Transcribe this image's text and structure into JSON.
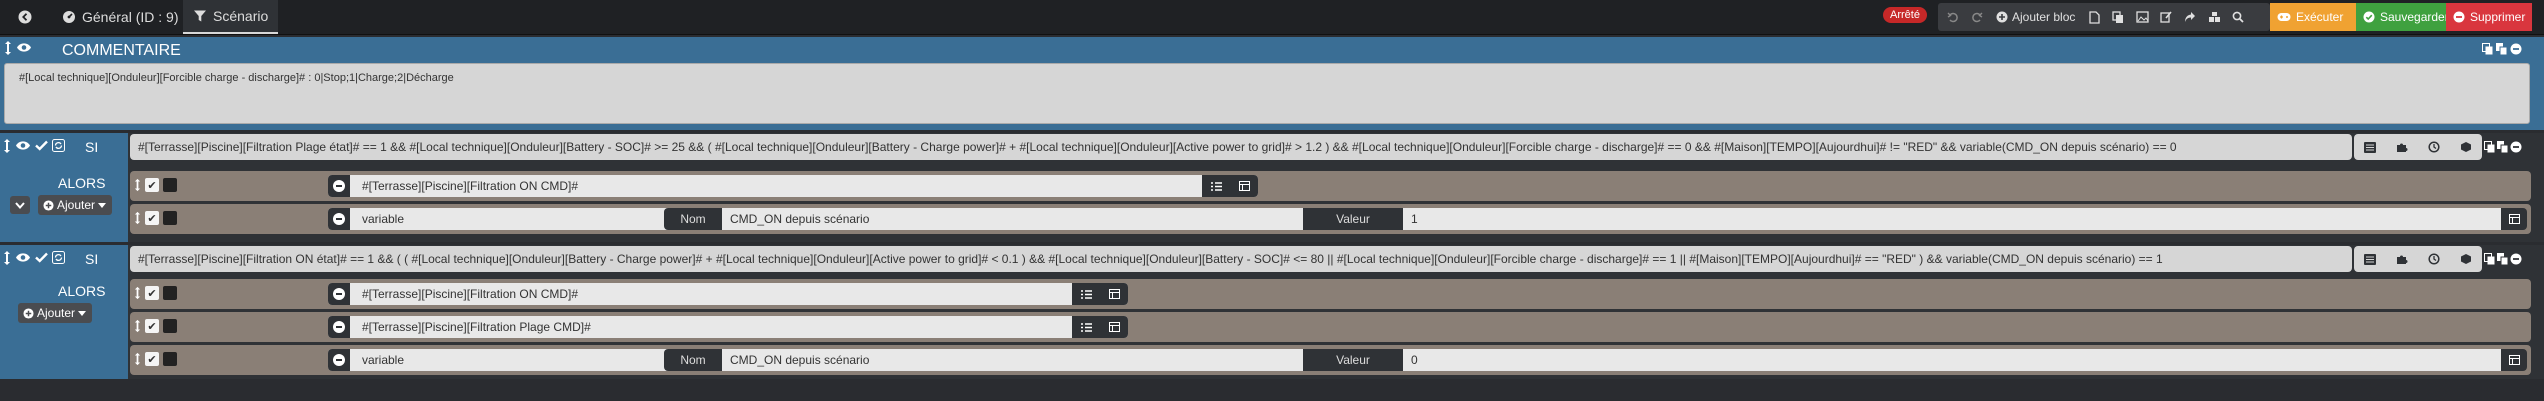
{
  "topbar": {
    "back_icon": "back-circle-icon",
    "tabs": [
      {
        "label": "Général (ID : 9)",
        "icon": "dashboard-icon"
      },
      {
        "label": "Scénario",
        "icon": "filter-icon"
      }
    ],
    "state_badge": "Arrêté",
    "add_block_label": "Ajouter bloc",
    "execute_label": "Exécuter",
    "save_label": "Sauvegarder",
    "delete_label": "Supprimer"
  },
  "comment": {
    "title": "COMMENTAIRE",
    "text": "#[Local technique][Onduleur][Forcible charge - discharge]# : 0|Stop;1|Charge;2|Décharge"
  },
  "blocks": [
    {
      "si_label": "SI",
      "alors_label": "ALORS",
      "add_label": "Ajouter",
      "condition": "#[Terrasse][Piscine][Filtration Plage état]# == 1 && #[Local technique][Onduleur][Battery - SOC]# >= 25 && ( #[Local technique][Onduleur][Battery - Charge power]# + #[Local technique][Onduleur][Active power to grid]# > 1.2 ) && #[Local technique][Onduleur][Forcible charge - discharge]# == 0 && #[Maison][TEMPO][Aujourdhui]# != \"RED\" && variable(CMD_ON depuis scénario) == 0",
      "actions": [
        {
          "text": "#[Terrasse][Piscine][Filtration ON CMD]#"
        },
        {
          "text": "variable",
          "nom_label": "Nom",
          "nom_value": "CMD_ON depuis scénario",
          "valeur_label": "Valeur",
          "valeur_value": "1"
        }
      ]
    },
    {
      "si_label": "SI",
      "alors_label": "ALORS",
      "add_label": "Ajouter",
      "condition": "#[Terrasse][Piscine][Filtration ON état]# == 1 && ( ( #[Local technique][Onduleur][Battery - Charge power]# + #[Local technique][Onduleur][Active power to grid]# < 0.1 ) && #[Local technique][Onduleur][Battery - SOC]# <= 80 || #[Local technique][Onduleur][Forcible charge - discharge]# == 1 || #[Maison][TEMPO][Aujourdhui]# == \"RED\" ) && variable(CMD_ON depuis scénario) == 1",
      "actions": [
        {
          "text": "#[Terrasse][Piscine][Filtration ON CMD]#"
        },
        {
          "text": "#[Terrasse][Piscine][Filtration Plage CMD]#"
        },
        {
          "text": "variable",
          "nom_label": "Nom",
          "nom_value": "CMD_ON depuis scénario",
          "valeur_label": "Valeur",
          "valeur_value": "0"
        }
      ]
    }
  ]
}
